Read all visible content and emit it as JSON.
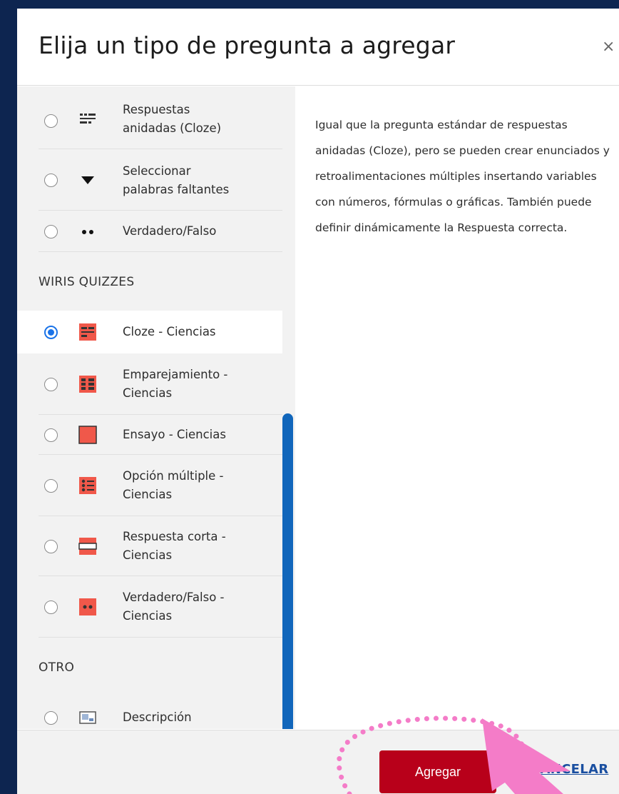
{
  "dialog": {
    "title": "Elija un tipo de pregunta a agregar",
    "close_glyph": "×"
  },
  "options": [
    {
      "label_line1": "Respuestas",
      "label_line2": "anidadas (Cloze)",
      "icon": "cloze-icon",
      "selected": false
    },
    {
      "label_line1": "Seleccionar",
      "label_line2": "palabras faltantes",
      "icon": "dropdown-arrow-icon",
      "selected": false
    },
    {
      "label_line1": "Verdadero/Falso",
      "icon": "true-false-dots-icon",
      "selected": false
    }
  ],
  "sections": {
    "wiris": "WIRIS QUIZZES",
    "otro": "OTRO"
  },
  "wiris_options": [
    {
      "label_line1": "Cloze - Ciencias",
      "icon": "wiris-cloze-icon",
      "selected": true
    },
    {
      "label_line1": "Emparejamiento -",
      "label_line2": "Ciencias",
      "icon": "wiris-matching-icon",
      "selected": false
    },
    {
      "label_line1": "Ensayo - Ciencias",
      "icon": "wiris-essay-icon",
      "selected": false
    },
    {
      "label_line1": "Opción múltiple -",
      "label_line2": "Ciencias",
      "icon": "wiris-multichoice-icon",
      "selected": false
    },
    {
      "label_line1": "Respuesta corta -",
      "label_line2": "Ciencias",
      "icon": "wiris-shortanswer-icon",
      "selected": false
    },
    {
      "label_line1": "Verdadero/Falso -",
      "label_line2": "Ciencias",
      "icon": "wiris-truefalse-icon",
      "selected": false
    }
  ],
  "other_options": [
    {
      "label_line1": "Descripción",
      "icon": "description-icon",
      "selected": false
    }
  ],
  "description": "Igual que la pregunta estándar de respuestas anidadas (Cloze), pero se pueden crear enunciados y retroalimentaciones múltiples insertando variables con números, fórmulas o gráficas. También puede definir dinámicamente la Respuesta correcta.",
  "footer": {
    "add_label": "Agregar",
    "cancel_label": "CANCELAR"
  },
  "colors": {
    "background": "#0d2550",
    "accent_red": "#b8001a",
    "wiris_icon": "#f0584a",
    "radio_selected": "#1a73e8",
    "scrollbar": "#1166bb",
    "annotation_pink": "#f47cc8"
  }
}
